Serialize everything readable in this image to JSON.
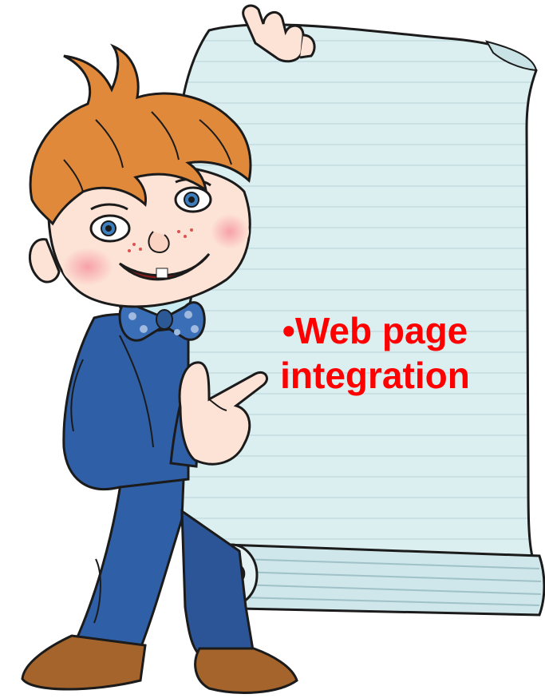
{
  "slide": {
    "bullet_line_1": "•Web page",
    "bullet_line_2": "integration",
    "text_color": "#ff0000",
    "background_color": "#ffffff"
  },
  "illustration": {
    "subject": "cartoon-boy-holding-scroll",
    "scroll_color": "#dbeef0",
    "suit_color": "#2f5fa6",
    "hair_color": "#e0893a"
  }
}
